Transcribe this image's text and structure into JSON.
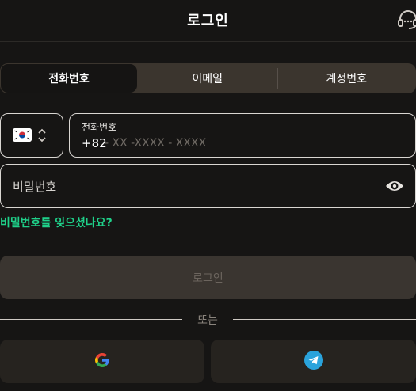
{
  "header": {
    "title": "로그인",
    "support_icon": "headset-icon"
  },
  "tabs": [
    {
      "label": "전화번호",
      "active": true
    },
    {
      "label": "이메일",
      "active": false
    },
    {
      "label": "계정번호",
      "active": false
    }
  ],
  "phone": {
    "country_flag": "south-korea-flag-icon",
    "label": "전화번호",
    "prefix": "+82",
    "placeholder": "- XX -XXXX - XXXX",
    "value": ""
  },
  "password": {
    "placeholder": "비밀번호",
    "value": "",
    "toggle_icon": "eye-icon"
  },
  "forgot_link": "비밀번호를 잊으셨나요?",
  "login_button": "로그인",
  "divider": "또는",
  "social": [
    {
      "icon": "google-icon"
    },
    {
      "icon": "telegram-icon"
    }
  ],
  "colors": {
    "background": "#161514",
    "accent_green": "#1fd18a",
    "tab_bar": "#3b352e",
    "button_disabled": "#3a3530",
    "social_button": "#26231f"
  }
}
